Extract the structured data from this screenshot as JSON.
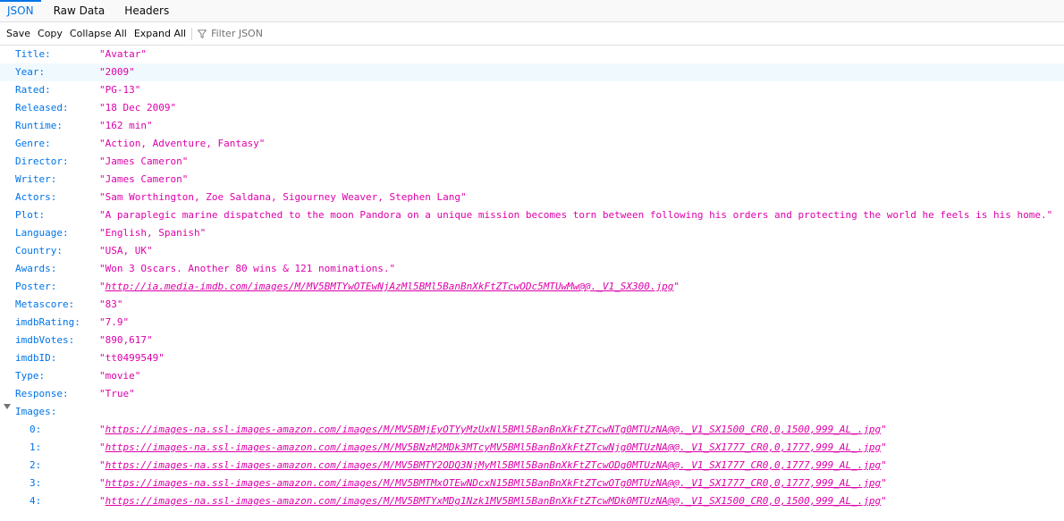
{
  "tabs": [
    {
      "label": "JSON",
      "active": true
    },
    {
      "label": "Raw Data",
      "active": false
    },
    {
      "label": "Headers",
      "active": false
    }
  ],
  "toolbar": {
    "save_label": "Save",
    "copy_label": "Copy",
    "collapse_label": "Collapse All",
    "expand_label": "Expand All",
    "filter_placeholder": "Filter JSON"
  },
  "rows": [
    {
      "key": "Title:",
      "value": "\"Avatar\""
    },
    {
      "key": "Year:",
      "value": "\"2009\""
    },
    {
      "key": "Rated:",
      "value": "\"PG-13\""
    },
    {
      "key": "Released:",
      "value": "\"18 Dec 2009\""
    },
    {
      "key": "Runtime:",
      "value": "\"162 min\""
    },
    {
      "key": "Genre:",
      "value": "\"Action, Adventure, Fantasy\""
    },
    {
      "key": "Director:",
      "value": "\"James Cameron\""
    },
    {
      "key": "Writer:",
      "value": "\"James Cameron\""
    },
    {
      "key": "Actors:",
      "value": "\"Sam Worthington, Zoe Saldana, Sigourney Weaver, Stephen Lang\""
    },
    {
      "key": "Plot:",
      "value": "\"A paraplegic marine dispatched to the moon Pandora on a unique mission becomes torn between following his orders and protecting the world he feels is his home.\""
    },
    {
      "key": "Language:",
      "value": "\"English, Spanish\""
    },
    {
      "key": "Country:",
      "value": "\"USA, UK\""
    },
    {
      "key": "Awards:",
      "value": "\"Won 3 Oscars. Another 80 wins & 121 nominations.\""
    },
    {
      "key": "Poster:",
      "value": "http://ia.media-imdb.com/images/M/MV5BMTYwOTEwNjAzMl5BMl5BanBnXkFtZTcwODc5MTUwMw@@._V1_SX300.jpg",
      "link": true
    },
    {
      "key": "Metascore:",
      "value": "\"83\""
    },
    {
      "key": "imdbRating:",
      "value": "\"7.9\""
    },
    {
      "key": "imdbVotes:",
      "value": "\"890,617\""
    },
    {
      "key": "imdbID:",
      "value": "\"tt0499549\""
    },
    {
      "key": "Type:",
      "value": "\"movie\""
    },
    {
      "key": "Response:",
      "value": "\"True\""
    }
  ],
  "images_key": "Images:",
  "images": [
    {
      "key": "0:",
      "value": "https://images-na.ssl-images-amazon.com/images/M/MV5BMjEyOTYyMzUxNl5BMl5BanBnXkFtZTcwNTg0MTUzNA@@._V1_SX1500_CR0,0,1500,999_AL_.jpg"
    },
    {
      "key": "1:",
      "value": "https://images-na.ssl-images-amazon.com/images/M/MV5BNzM2MDk3MTcyMV5BMl5BanBnXkFtZTcwNjg0MTUzNA@@._V1_SX1777_CR0,0,1777,999_AL_.jpg"
    },
    {
      "key": "2:",
      "value": "https://images-na.ssl-images-amazon.com/images/M/MV5BMTY2ODQ3NjMyMl5BMl5BanBnXkFtZTcwODg0MTUzNA@@._V1_SX1777_CR0,0,1777,999_AL_.jpg"
    },
    {
      "key": "3:",
      "value": "https://images-na.ssl-images-amazon.com/images/M/MV5BMTMxOTEwNDcxN15BMl5BanBnXkFtZTcwOTg0MTUzNA@@._V1_SX1777_CR0,0,1777,999_AL_.jpg"
    },
    {
      "key": "4:",
      "value": "https://images-na.ssl-images-amazon.com/images/M/MV5BMTYxMDg1Nzk1MV5BMl5BanBnXkFtZTcwMDk0MTUzNA@@._V1_SX1500_CR0,0,1500,999_AL_.jpg"
    }
  ],
  "colors": {
    "accent": "#0074e8",
    "key": "#0074e8",
    "string": "#dd00a9",
    "row_hover": "#f0f9fe"
  }
}
